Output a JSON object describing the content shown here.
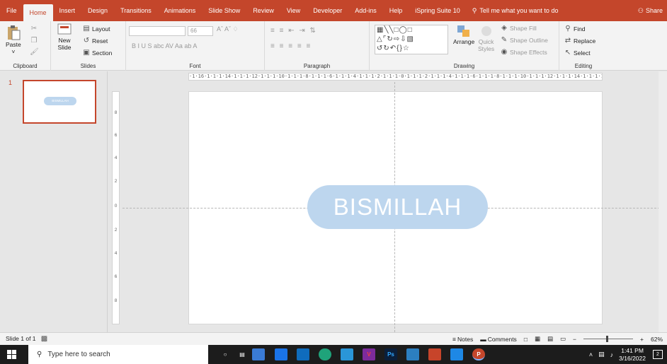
{
  "tabs": [
    "File",
    "Home",
    "Insert",
    "Design",
    "Transitions",
    "Animations",
    "Slide Show",
    "Review",
    "View",
    "Developer",
    "Add-ins",
    "Help",
    "iSpring Suite 10"
  ],
  "tell_me": "Tell me what you want to do",
  "share": "Share",
  "ribbon": {
    "clipboard": {
      "paste": "Paste",
      "label": "Clipboard"
    },
    "slides": {
      "new_slide": "New",
      "new_slide2": "Slide",
      "layout": "Layout",
      "reset": "Reset",
      "section": "Section",
      "label": "Slides"
    },
    "font": {
      "size": "66",
      "label": "Font",
      "row2": "B  I  U  S  abc  AV  Aa  ab  A"
    },
    "paragraph": {
      "label": "Paragraph"
    },
    "drawing": {
      "arrange": "Arrange",
      "quick_styles": "Quick",
      "quick_styles2": "Styles",
      "shape_fill": "Shape Fill",
      "shape_outline": "Shape Outline",
      "shape_effects": "Shape Effects",
      "label": "Drawing"
    },
    "editing": {
      "find": "Find",
      "replace": "Replace",
      "select": "Select",
      "label": "Editing"
    }
  },
  "ruler_text": "·1·16·1·1·1·14·1·1·1·12·1·1·1·10·1·1·1·8·1·1·1·6·1·1·1·4·1·1·1·2·1·1·1·0·1·1·1·2·1·1·1·4·1·1·1·6·1·1·1·8·1·1·1·10·1·1·1·12·1·1·1·14·1·1·1·16·",
  "vruler_marks": [
    "8",
    "6",
    "4",
    "2",
    "0",
    "2",
    "4",
    "6",
    "8"
  ],
  "thumbnail": {
    "number": "1",
    "text": "BISMILLAH"
  },
  "slide": {
    "text": "BISMILLAH",
    "pill_color": "#bdd6ee"
  },
  "status": {
    "slide_of": "Slide 1 of 1",
    "notes": "Notes",
    "comments": "Comments",
    "zoom": "62%"
  },
  "taskbar": {
    "search_placeholder": "Type here to search",
    "time": "1:41 PM",
    "date": "3/16/2022"
  },
  "colors": {
    "accent": "#c4462b",
    "ribbon_bg": "#f3f3f3",
    "taskbar_bg": "#1c1c1c"
  }
}
